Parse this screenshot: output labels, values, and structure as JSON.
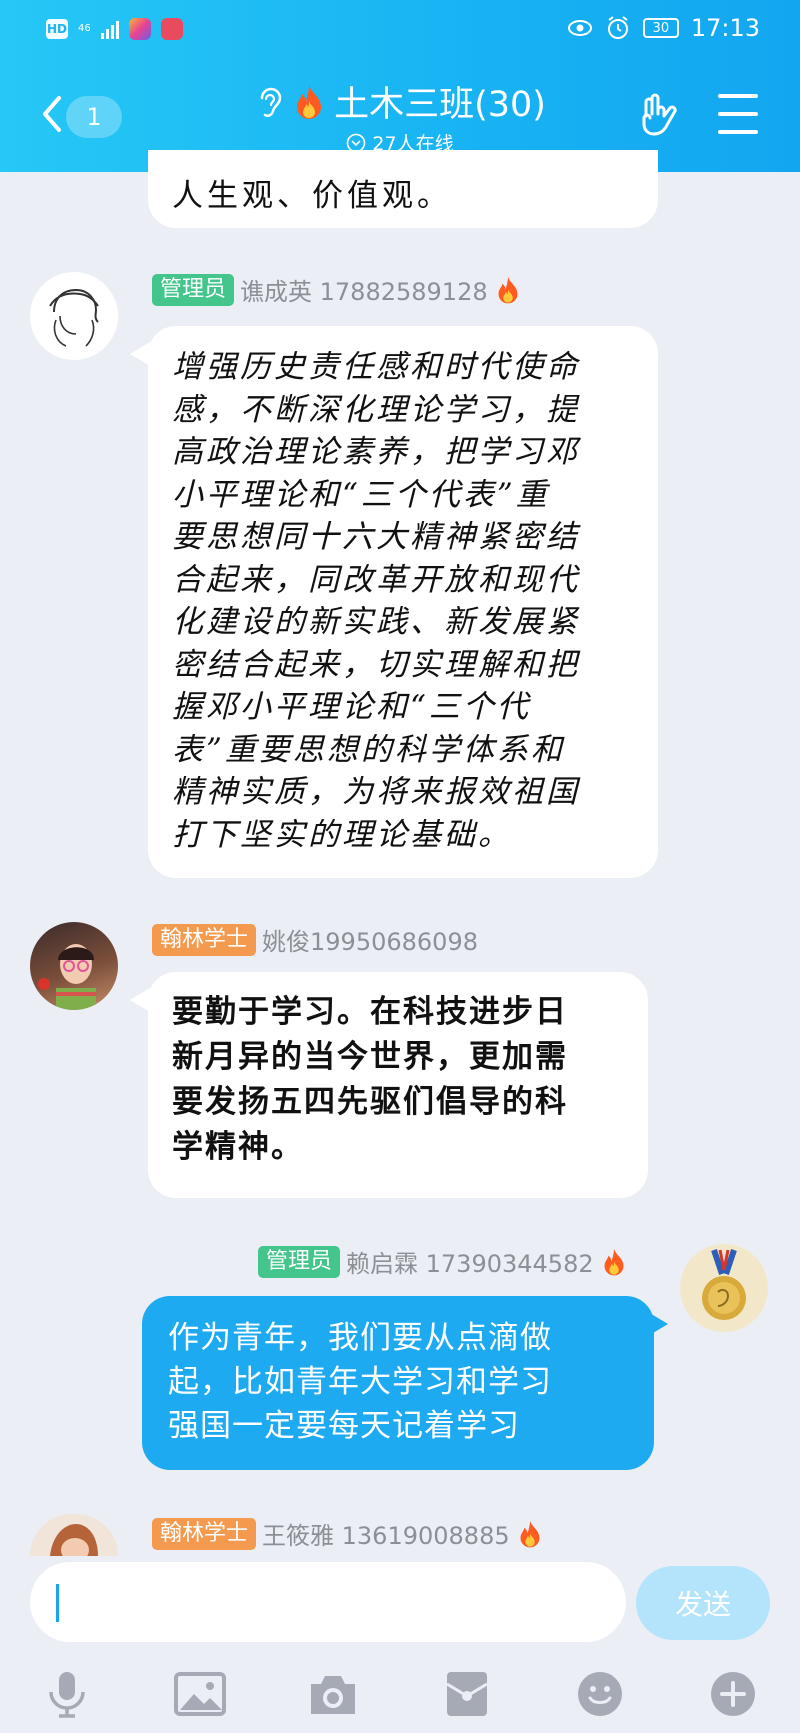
{
  "status_bar": {
    "hd": "HD",
    "network": "46",
    "battery": "30",
    "time": "17:13"
  },
  "header": {
    "back_count": "1",
    "title": "土木三班(30)",
    "online": "27人在线"
  },
  "messages": [
    {
      "id": "top",
      "text": "人生观、价值观。"
    },
    {
      "id": "m1",
      "tag": "管理员",
      "sender": "谯成英 17882589128",
      "lines": [
        "增强历史责任感和时代使命",
        "感，不断深化理论学习，提",
        "高政治理论素养，把学习邓",
        "小平理论和“三个代表”重",
        "要思想同十六大精神紧密结",
        "合起来，同改革开放和现代",
        "化建设的新实践、新发展紧",
        "密结合起来，切实理解和把",
        "握邓小平理论和“三个代",
        "表”重要思想的科学体系和",
        "精神实质，为将来报效祖国",
        "打下坚实的理论基础。"
      ]
    },
    {
      "id": "m2",
      "tag": "翰林学士",
      "sender": "姚俊19950686098",
      "lines": [
        "要勤于学习。在科技进步日",
        "新月异的当今世界，更加需",
        "要发扬五四先驱们倡导的科",
        "学精神。"
      ]
    },
    {
      "id": "m3",
      "tag": "管理员",
      "sender": "赖启霖 17390344582",
      "lines": [
        "作为青年，我们要从点滴做",
        "起，比如青年大学习和学习",
        "强国一定要每天记着学习"
      ]
    },
    {
      "id": "m4",
      "tag": "翰林学士",
      "sender": "王筱雅 13619008885"
    }
  ],
  "composer": {
    "send_label": "发送"
  },
  "toolbar": [
    "mic-icon",
    "image-icon",
    "camera-icon",
    "red-packet-icon",
    "emoji-icon",
    "plus-icon"
  ]
}
